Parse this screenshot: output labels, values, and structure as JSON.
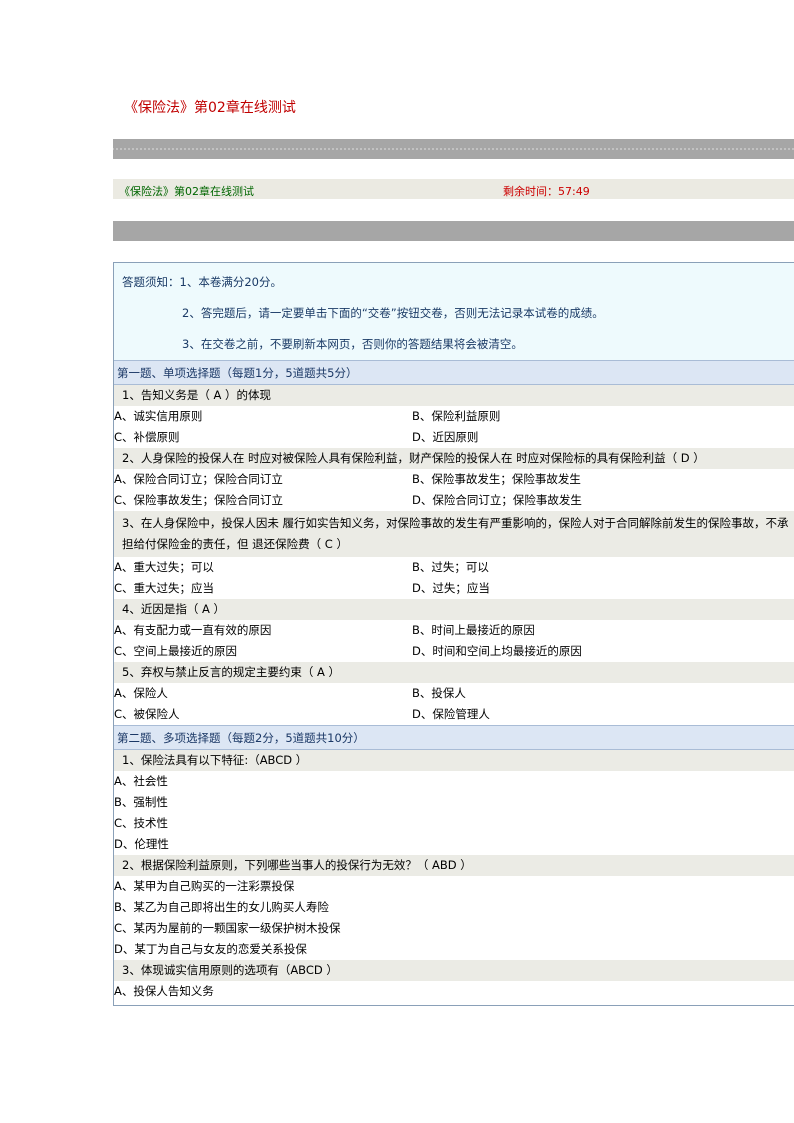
{
  "page_title": "《保险法》第02章在线测试",
  "info": {
    "title": "《保险法》第02章在线测试",
    "timer": "剩余时间：57:49"
  },
  "notice": {
    "line1": "答题须知：1、本卷满分20分。",
    "line2": "2、答完题后，请一定要单击下面的“交卷”按钮交卷，否则无法记录本试卷的成绩。",
    "line3": "3、在交卷之前，不要刷新本网页，否则你的答题结果将会被清空。"
  },
  "section1": {
    "header": "第一题、单项选择题（每题1分，5道题共5分）",
    "questions": [
      {
        "text": "1、告知义务是（ A ）的体现",
        "options": [
          "A、诚实信用原则",
          "B、保险利益原则",
          "C、补偿原则",
          "D、近因原则"
        ]
      },
      {
        "text": "2、人身保险的投保人在 时应对被保险人具有保险利益，财产保险的投保人在 时应对保险标的具有保险利益（ D ）",
        "options": [
          "A、保险合同订立；保险合同订立",
          "B、保险事故发生；保险事故发生",
          "C、保险事故发生；保险合同订立",
          "D、保险合同订立；保险事故发生"
        ]
      },
      {
        "text": "3、在人身保险中，投保人因未 履行如实告知义务，对保险事故的发生有严重影响的，保险人对于合同解除前发生的保险事故，不承担给付保险金的责任，但 退还保险费（ C ）",
        "options": [
          "A、重大过失；可以",
          "B、过失；可以",
          "C、重大过失；应当",
          "D、过失；应当"
        ]
      },
      {
        "text": "4、近因是指（ A ）",
        "options": [
          "A、有支配力或一直有效的原因",
          "B、时间上最接近的原因",
          "C、空间上最接近的原因",
          "D、时间和空间上均最接近的原因"
        ]
      },
      {
        "text": "5、弃权与禁止反言的规定主要约束（ A ）",
        "options": [
          "A、保险人",
          "B、投保人",
          "C、被保险人",
          "D、保险管理人"
        ]
      }
    ]
  },
  "section2": {
    "header": "第二题、多项选择题（每题2分，5道题共10分）",
    "questions": [
      {
        "text": "1、保险法具有以下特征:（ABCD ）",
        "options": [
          "A、社会性",
          "B、强制性",
          "C、技术性",
          "D、伦理性"
        ]
      },
      {
        "text": "2、根据保险利益原则，下列哪些当事人的投保行为无效？（  ABD ）",
        "options": [
          "A、某甲为自己购买的一注彩票投保",
          "B、某乙为自己即将出生的女儿购买人寿险",
          "C、某丙为屋前的一颗国家一级保护树木投保",
          "D、某丁为自己与女友的恋爱关系投保"
        ]
      },
      {
        "text": "3、体现诚实信用原则的选项有（ABCD ）",
        "options": [
          "A、投保人告知义务"
        ]
      }
    ]
  }
}
